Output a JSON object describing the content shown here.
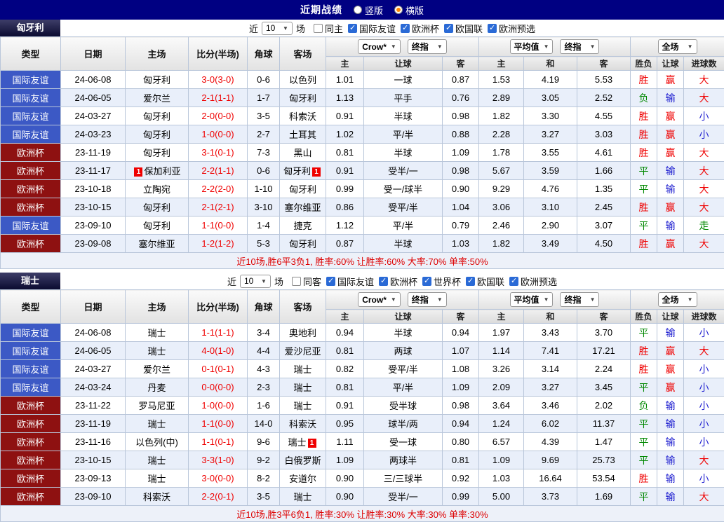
{
  "header": {
    "title": "近期战绩",
    "radios": [
      {
        "label": "竖版",
        "checked": false
      },
      {
        "label": "横版",
        "checked": true
      }
    ]
  },
  "controls": {
    "near_label": "近",
    "count": "10",
    "matches_label": "场",
    "bookmaker": "Crow*",
    "final_odds": "终指",
    "average": "平均值",
    "final_odds2": "终指",
    "scope": "全场"
  },
  "columns": {
    "type": "类型",
    "date": "日期",
    "home": "主场",
    "score": "比分(半场)",
    "corner": "角球",
    "away": "客场",
    "asia_home": "主",
    "asia_hcap": "让球",
    "asia_away": "客",
    "eu_home": "主",
    "eu_draw": "和",
    "eu_away": "客",
    "res_wdl": "胜负",
    "res_hcap": "让球",
    "res_goals": "进球数"
  },
  "sections": [
    {
      "team": "匈牙利",
      "filter": {
        "checkboxes": [
          {
            "label": "同主",
            "checked": false
          },
          {
            "label": "国际友谊",
            "checked": true
          },
          {
            "label": "欧洲杯",
            "checked": true
          },
          {
            "label": "欧国联",
            "checked": true
          },
          {
            "label": "欧洲预选",
            "checked": true
          }
        ]
      },
      "rows": [
        {
          "league": "国际友谊",
          "lc": "friendly",
          "date": "24-06-08",
          "home": "匈牙利",
          "hc": "focus",
          "score": "3-0(3-0)",
          "corner": "0-6",
          "away": "以色列",
          "o1": "1.01",
          "o2": "一球",
          "o3": "0.87",
          "e1": "1.53",
          "e2": "4.19",
          "e3": "5.53",
          "r1": "胜",
          "r1c": "red",
          "r2": "赢",
          "r2c": "red",
          "r3": "大",
          "r3c": "red"
        },
        {
          "league": "国际友谊",
          "lc": "friendly",
          "date": "24-06-05",
          "home": "爱尔兰",
          "score": "2-1(1-1)",
          "corner": "1-7",
          "away": "匈牙利",
          "ac": "focus",
          "o1": "1.13",
          "o2": "平手",
          "o3": "0.76",
          "e1": "2.89",
          "e2": "3.05",
          "e3": "2.52",
          "r1": "负",
          "r1c": "green",
          "r2": "输",
          "r2c": "blue",
          "r3": "大",
          "r3c": "red"
        },
        {
          "league": "国际友谊",
          "lc": "friendly",
          "date": "24-03-27",
          "home": "匈牙利",
          "hc": "focus",
          "score": "2-0(0-0)",
          "corner": "3-5",
          "away": "科索沃",
          "o1": "0.91",
          "o2": "半球",
          "o3": "0.98",
          "e1": "1.82",
          "e2": "3.30",
          "e3": "4.55",
          "r1": "胜",
          "r1c": "red",
          "r2": "赢",
          "r2c": "red",
          "r3": "小",
          "r3c": "blue"
        },
        {
          "league": "国际友谊",
          "lc": "friendly",
          "date": "24-03-23",
          "home": "匈牙利",
          "hc": "focus",
          "score": "1-0(0-0)",
          "corner": "2-7",
          "away": "土耳其",
          "o1": "1.02",
          "o2": "平/半",
          "o3": "0.88",
          "e1": "2.28",
          "e2": "3.27",
          "e3": "3.03",
          "r1": "胜",
          "r1c": "red",
          "r2": "赢",
          "r2c": "red",
          "r3": "小",
          "r3c": "blue"
        },
        {
          "league": "欧洲杯",
          "lc": "eurocup",
          "date": "23-11-19",
          "home": "匈牙利",
          "hc": "focus",
          "score": "3-1(0-1)",
          "corner": "7-3",
          "away": "黑山",
          "o1": "0.81",
          "o2": "半球",
          "o3": "1.09",
          "e1": "1.78",
          "e2": "3.55",
          "e3": "4.61",
          "r1": "胜",
          "r1c": "red",
          "r2": "赢",
          "r2c": "red",
          "r3": "大",
          "r3c": "red"
        },
        {
          "league": "欧洲杯",
          "lc": "eurocup",
          "date": "23-11-17",
          "home": "保加利亚",
          "hcard": "1",
          "score": "2-2(1-1)",
          "corner": "0-6",
          "away": "匈牙利",
          "ac": "focus",
          "acard": "1",
          "o1": "0.91",
          "o2": "受半/一",
          "o3": "0.98",
          "e1": "5.67",
          "e2": "3.59",
          "e3": "1.66",
          "r1": "平",
          "r1c": "green",
          "r2": "输",
          "r2c": "blue",
          "r3": "大",
          "r3c": "red"
        },
        {
          "league": "欧洲杯",
          "lc": "eurocup",
          "date": "23-10-18",
          "home": "立陶宛",
          "score": "2-2(2-0)",
          "corner": "1-10",
          "away": "匈牙利",
          "ac": "focus",
          "o1": "0.99",
          "o2": "受一/球半",
          "o3": "0.90",
          "e1": "9.29",
          "e2": "4.76",
          "e3": "1.35",
          "r1": "平",
          "r1c": "green",
          "r2": "输",
          "r2c": "blue",
          "r3": "大",
          "r3c": "red"
        },
        {
          "league": "欧洲杯",
          "lc": "eurocup",
          "date": "23-10-15",
          "home": "匈牙利",
          "hc": "focus",
          "score": "2-1(2-1)",
          "corner": "3-10",
          "away": "塞尔维亚",
          "o1": "0.86",
          "o2": "受平/半",
          "o3": "1.04",
          "e1": "3.06",
          "e2": "3.10",
          "e3": "2.45",
          "r1": "胜",
          "r1c": "red",
          "r2": "赢",
          "r2c": "red",
          "r3": "大",
          "r3c": "red"
        },
        {
          "league": "国际友谊",
          "lc": "friendly",
          "date": "23-09-10",
          "home": "匈牙利",
          "hc": "focus",
          "score": "1-1(0-0)",
          "corner": "1-4",
          "away": "捷克",
          "o1": "1.12",
          "o2": "平/半",
          "o3": "0.79",
          "e1": "2.46",
          "e2": "2.90",
          "e3": "3.07",
          "r1": "平",
          "r1c": "green",
          "r2": "输",
          "r2c": "blue",
          "r3": "走",
          "r3c": "green"
        },
        {
          "league": "欧洲杯",
          "lc": "eurocup",
          "date": "23-09-08",
          "home": "塞尔维亚",
          "score": "1-2(1-2)",
          "corner": "5-3",
          "away": "匈牙利",
          "ac": "focus",
          "o1": "0.87",
          "o2": "半球",
          "o3": "1.03",
          "e1": "1.82",
          "e2": "3.49",
          "e3": "4.50",
          "r1": "胜",
          "r1c": "red",
          "r2": "赢",
          "r2c": "red",
          "r3": "大",
          "r3c": "red"
        }
      ],
      "footer": "近10场,胜6平3负1, 胜率:60% 让胜率:60% 大率:70% 单率:50%"
    },
    {
      "team": "瑞士",
      "filter": {
        "checkboxes": [
          {
            "label": "同客",
            "checked": false
          },
          {
            "label": "国际友谊",
            "checked": true
          },
          {
            "label": "欧洲杯",
            "checked": true
          },
          {
            "label": "世界杯",
            "checked": true
          },
          {
            "label": "欧国联",
            "checked": true
          },
          {
            "label": "欧洲预选",
            "checked": true
          }
        ]
      },
      "rows": [
        {
          "league": "国际友谊",
          "lc": "friendly",
          "date": "24-06-08",
          "home": "瑞士",
          "hc": "focus",
          "score": "1-1(1-1)",
          "corner": "3-4",
          "away": "奥地利",
          "o1": "0.94",
          "o2": "半球",
          "o3": "0.94",
          "e1": "1.97",
          "e2": "3.43",
          "e3": "3.70",
          "r1": "平",
          "r1c": "green",
          "r2": "输",
          "r2c": "blue",
          "r3": "小",
          "r3c": "blue"
        },
        {
          "league": "国际友谊",
          "lc": "friendly",
          "date": "24-06-05",
          "home": "瑞士",
          "hc": "focus",
          "score": "4-0(1-0)",
          "corner": "4-4",
          "away": "爱沙尼亚",
          "o1": "0.81",
          "o2": "两球",
          "o3": "1.07",
          "e1": "1.14",
          "e2": "7.41",
          "e3": "17.21",
          "r1": "胜",
          "r1c": "red",
          "r2": "赢",
          "r2c": "red",
          "r3": "大",
          "r3c": "red"
        },
        {
          "league": "国际友谊",
          "lc": "friendly",
          "date": "24-03-27",
          "home": "爱尔兰",
          "score": "0-1(0-1)",
          "corner": "4-3",
          "away": "瑞士",
          "ac": "focus",
          "o1": "0.82",
          "o2": "受平/半",
          "o3": "1.08",
          "e1": "3.26",
          "e2": "3.14",
          "e3": "2.24",
          "r1": "胜",
          "r1c": "red",
          "r2": "赢",
          "r2c": "red",
          "r3": "小",
          "r3c": "blue"
        },
        {
          "league": "国际友谊",
          "lc": "friendly",
          "date": "24-03-24",
          "home": "丹麦",
          "score": "0-0(0-0)",
          "corner": "2-3",
          "away": "瑞士",
          "ac": "focus",
          "o1": "0.81",
          "o2": "平/半",
          "o3": "1.09",
          "e1": "2.09",
          "e2": "3.27",
          "e3": "3.45",
          "r1": "平",
          "r1c": "green",
          "r2": "赢",
          "r2c": "red",
          "r3": "小",
          "r3c": "blue"
        },
        {
          "league": "欧洲杯",
          "lc": "eurocup",
          "date": "23-11-22",
          "home": "罗马尼亚",
          "score": "1-0(0-0)",
          "corner": "1-6",
          "away": "瑞士",
          "ac": "focus",
          "o1": "0.91",
          "o2": "受半球",
          "o3": "0.98",
          "e1": "3.64",
          "e2": "3.46",
          "e3": "2.02",
          "r1": "负",
          "r1c": "green",
          "r2": "输",
          "r2c": "blue",
          "r3": "小",
          "r3c": "blue"
        },
        {
          "league": "欧洲杯",
          "lc": "eurocup",
          "date": "23-11-19",
          "home": "瑞士",
          "hc": "focus",
          "score": "1-1(0-0)",
          "corner": "14-0",
          "away": "科索沃",
          "o1": "0.95",
          "o2": "球半/两",
          "o3": "0.94",
          "e1": "1.24",
          "e2": "6.02",
          "e3": "11.37",
          "r1": "平",
          "r1c": "green",
          "r2": "输",
          "r2c": "blue",
          "r3": "小",
          "r3c": "blue"
        },
        {
          "league": "欧洲杯",
          "lc": "eurocup",
          "date": "23-11-16",
          "home": "以色列(中)",
          "score": "1-1(0-1)",
          "corner": "9-6",
          "away": "瑞士",
          "ac": "focus",
          "acard": "1",
          "o1": "1.11",
          "o2": "受一球",
          "o3": "0.80",
          "e1": "6.57",
          "e2": "4.39",
          "e3": "1.47",
          "r1": "平",
          "r1c": "green",
          "r2": "输",
          "r2c": "blue",
          "r3": "小",
          "r3c": "blue"
        },
        {
          "league": "欧洲杯",
          "lc": "eurocup",
          "date": "23-10-15",
          "home": "瑞士",
          "hc": "focus",
          "score": "3-3(1-0)",
          "corner": "9-2",
          "away": "白俄罗斯",
          "o1": "1.09",
          "o2": "两球半",
          "o3": "0.81",
          "e1": "1.09",
          "e2": "9.69",
          "e3": "25.73",
          "r1": "平",
          "r1c": "green",
          "r2": "输",
          "r2c": "blue",
          "r3": "大",
          "r3c": "red"
        },
        {
          "league": "欧洲杯",
          "lc": "eurocup",
          "date": "23-09-13",
          "home": "瑞士",
          "hc": "focus",
          "score": "3-0(0-0)",
          "corner": "8-2",
          "away": "安道尔",
          "o1": "0.90",
          "o2": "三/三球半",
          "o3": "0.92",
          "e1": "1.03",
          "e2": "16.64",
          "e3": "53.54",
          "r1": "胜",
          "r1c": "red",
          "r2": "输",
          "r2c": "blue",
          "r3": "小",
          "r3c": "blue"
        },
        {
          "league": "欧洲杯",
          "lc": "eurocup",
          "date": "23-09-10",
          "home": "科索沃",
          "score": "2-2(0-1)",
          "corner": "3-5",
          "away": "瑞士",
          "ac": "focus",
          "o1": "0.90",
          "o2": "受半/一",
          "o3": "0.99",
          "e1": "5.00",
          "e2": "3.73",
          "e3": "1.69",
          "r1": "平",
          "r1c": "green",
          "r2": "输",
          "r2c": "blue",
          "r3": "大",
          "r3c": "red"
        }
      ],
      "footer": "近10场,胜3平6负1, 胜率:30% 让胜率:30% 大率:30% 单率:30%"
    }
  ]
}
